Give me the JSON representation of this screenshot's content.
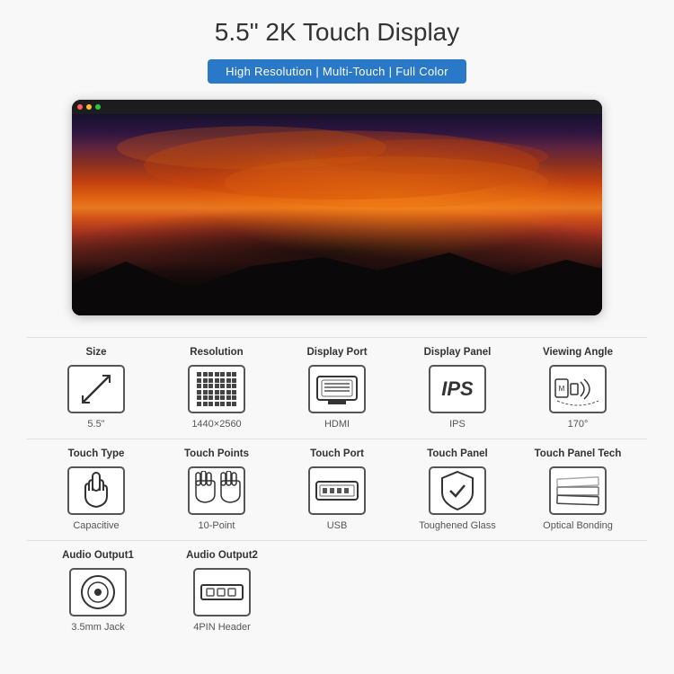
{
  "title": "5.5\" 2K Touch Display",
  "badge": "High Resolution | Multi-Touch | Full Color",
  "specs_rows": [
    [
      {
        "label": "Size",
        "icon": "size",
        "value": "5.5\""
      },
      {
        "label": "Resolution",
        "icon": "resolution",
        "value": "1440×2560"
      },
      {
        "label": "Display Port",
        "icon": "hdmi",
        "value": "HDMI"
      },
      {
        "label": "Display Panel",
        "icon": "ips",
        "value": "IPS"
      },
      {
        "label": "Viewing Angle",
        "icon": "viewing",
        "value": "170°"
      }
    ],
    [
      {
        "label": "Touch Type",
        "icon": "hand",
        "value": "Capacitive"
      },
      {
        "label": "Touch Points",
        "icon": "multihand",
        "value": "10-Point"
      },
      {
        "label": "Touch Port",
        "icon": "usb",
        "value": "USB"
      },
      {
        "label": "Touch Panel",
        "icon": "shield",
        "value": "Toughened Glass"
      },
      {
        "label": "Touch Panel Tech",
        "icon": "optical",
        "value": "Optical Bonding"
      }
    ],
    [
      {
        "label": "Audio Output1",
        "icon": "speaker",
        "value": "3.5mm Jack"
      },
      {
        "label": "Audio Output2",
        "icon": "pin4",
        "value": "4PIN Header"
      }
    ]
  ]
}
